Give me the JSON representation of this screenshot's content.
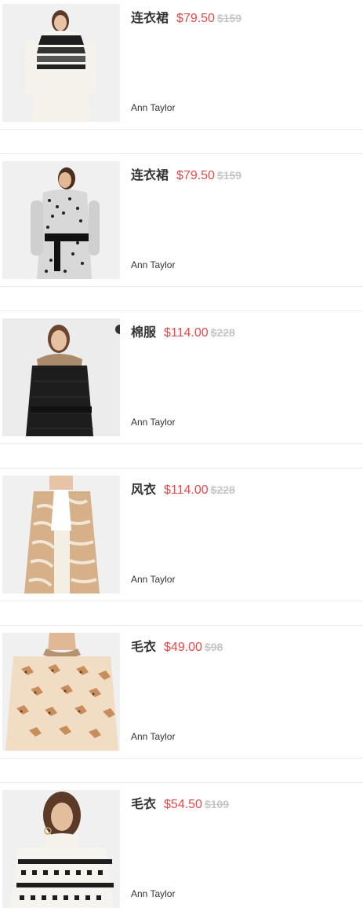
{
  "products": [
    {
      "name": "连衣裙",
      "price": "$79.50",
      "original_price": "$159",
      "brand": "Ann Taylor",
      "image": "black-white-striped-sweater-dress"
    },
    {
      "name": "连衣裙",
      "price": "$79.50",
      "original_price": "$159",
      "brand": "Ann Taylor",
      "image": "leopard-print-knit-dress"
    },
    {
      "name": "棉服",
      "price": "$114.00",
      "original_price": "$228",
      "brand": "Ann Taylor",
      "image": "black-puffer-coat-fur-collar"
    },
    {
      "name": "风衣",
      "price": "$114.00",
      "original_price": "$228",
      "brand": "Ann Taylor",
      "image": "tan-zebra-print-coat"
    },
    {
      "name": "毛衣",
      "price": "$49.00",
      "original_price": "$98",
      "brand": "Ann Taylor",
      "image": "horse-print-sweater"
    },
    {
      "name": "毛衣",
      "price": "$54.50",
      "original_price": "$109",
      "brand": "Ann Taylor",
      "image": "fair-isle-turtleneck-sweater"
    }
  ]
}
